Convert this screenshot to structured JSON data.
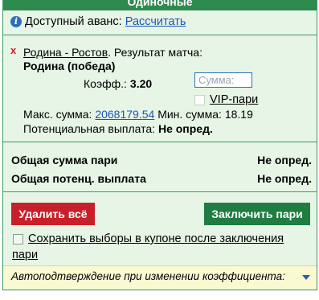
{
  "header": {
    "title": "Одиночные"
  },
  "advance": {
    "label": "Доступный аванс:",
    "link": "Рассчитать"
  },
  "bet": {
    "remove": "x",
    "match_link": "Родина - Ростов",
    "match_suffix": ". Результат матча:",
    "outcome": "Родина (победа)",
    "coef_label": "Коэфф.:",
    "coef_value": "3.20",
    "stake_placeholder": "Сумма:",
    "vip_label": "VIP-пари",
    "max_label": "Макс. сумма:",
    "max_value": "2068179.54",
    "min_label": "Мин. сумма:",
    "min_value": "18.19",
    "payout_label": "Потенциальная выплата:",
    "payout_value": "Не опред."
  },
  "totals": {
    "sum_label": "Общая сумма пари",
    "sum_value": "Не опред.",
    "payout_label": "Общая потенц. выплата",
    "payout_value": "Не опред."
  },
  "buttons": {
    "delete_all": "Удалить всё",
    "place": "Заключить пари"
  },
  "save_selections": {
    "line1": "Сохранить выборы в купоне после заключения",
    "line2": "пари"
  },
  "auto_confirm": {
    "label": "Автоподтверждение при изменении коэффициента:"
  },
  "colors": {
    "header_bg": "#2e8b4e",
    "panel_bg": "#e6f5e6",
    "delete_btn": "#c8202b",
    "place_btn": "#1f7d42",
    "link": "#1a56b5",
    "auto_bg": "#fafad2"
  }
}
